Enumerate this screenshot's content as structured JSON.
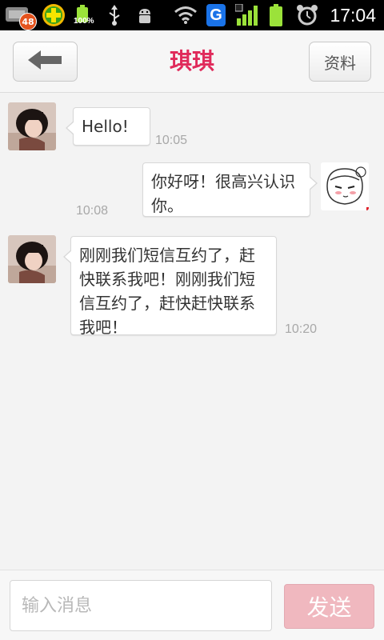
{
  "status_bar": {
    "notification_count": "48",
    "battery_percent": "100%",
    "network_label": "G",
    "time": "17:04",
    "icons": [
      "app-notification-icon",
      "plus-app-icon",
      "battery-icon",
      "usb-icon",
      "android-debug-icon",
      "wifi-icon",
      "g-app-icon",
      "signal-icon",
      "battery-full-icon",
      "alarm-icon"
    ]
  },
  "header": {
    "title": "琪琪",
    "back_icon": "back-arrow-icon",
    "profile_label": "资料"
  },
  "messages": [
    {
      "side": "left",
      "text": "Hello!",
      "time": "10:05"
    },
    {
      "side": "right",
      "text": "你好呀！很高兴认识你。",
      "time": "10:08"
    },
    {
      "side": "left",
      "text": "刚刚我们短信互约了，赶快联系我吧！刚刚我们短信互约了，赶快赶快联系我吧！",
      "time": "10:20"
    }
  ],
  "input": {
    "placeholder": "输入消息",
    "value": "",
    "send_label": "发送"
  },
  "colors": {
    "title": "#e02b5b",
    "send_button": "#f0b8bf",
    "background": "#f3f3f3"
  }
}
